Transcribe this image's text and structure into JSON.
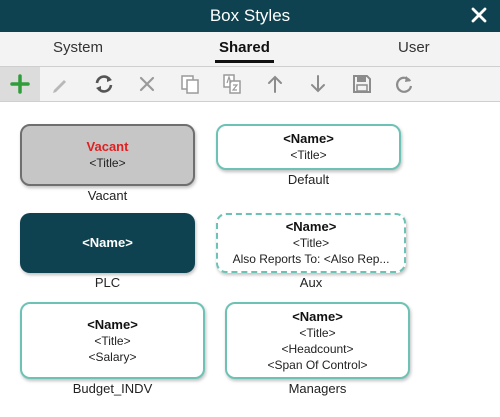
{
  "window": {
    "title": "Box Styles",
    "close_icon": "close-icon"
  },
  "tabs": [
    {
      "label": "System",
      "active": false
    },
    {
      "label": "Shared",
      "active": true
    },
    {
      "label": "User",
      "active": false
    }
  ],
  "toolbar": {
    "buttons": [
      {
        "icon": "add-icon",
        "enabled": true
      },
      {
        "icon": "edit-icon",
        "enabled": false
      },
      {
        "icon": "refresh-icon",
        "enabled": true
      },
      {
        "icon": "delete-icon",
        "enabled": false
      },
      {
        "icon": "copy-icon",
        "enabled": false
      },
      {
        "icon": "copy-to-icon",
        "enabled": false
      },
      {
        "icon": "move-up-icon",
        "enabled": false
      },
      {
        "icon": "move-down-icon",
        "enabled": false
      },
      {
        "icon": "save-icon",
        "enabled": false
      },
      {
        "icon": "reset-icon",
        "enabled": false
      }
    ]
  },
  "styles": [
    {
      "caption": "Vacant",
      "lines": [
        "Vacant",
        "<Title>"
      ]
    },
    {
      "caption": "Default",
      "lines": [
        "<Name>",
        "<Title>"
      ]
    },
    {
      "caption": "PLC",
      "lines": [
        "<Name>"
      ]
    },
    {
      "caption": "Aux",
      "lines": [
        "<Name>",
        "<Title>",
        "Also Reports To: <Also Rep..."
      ]
    },
    {
      "caption": "Budget_INDV",
      "lines": [
        "<Name>",
        "<Title>",
        "<Salary>"
      ]
    },
    {
      "caption": "Managers",
      "lines": [
        "<Name>",
        "<Title>",
        "<Headcount>",
        "<Span Of Control>"
      ]
    }
  ],
  "colors": {
    "header": "#0e4250",
    "accent_green": "#2e9d3a",
    "box_border": "#6cc3b5",
    "vacant_red": "#e02020",
    "vacant_fill": "#c6c6c6"
  }
}
